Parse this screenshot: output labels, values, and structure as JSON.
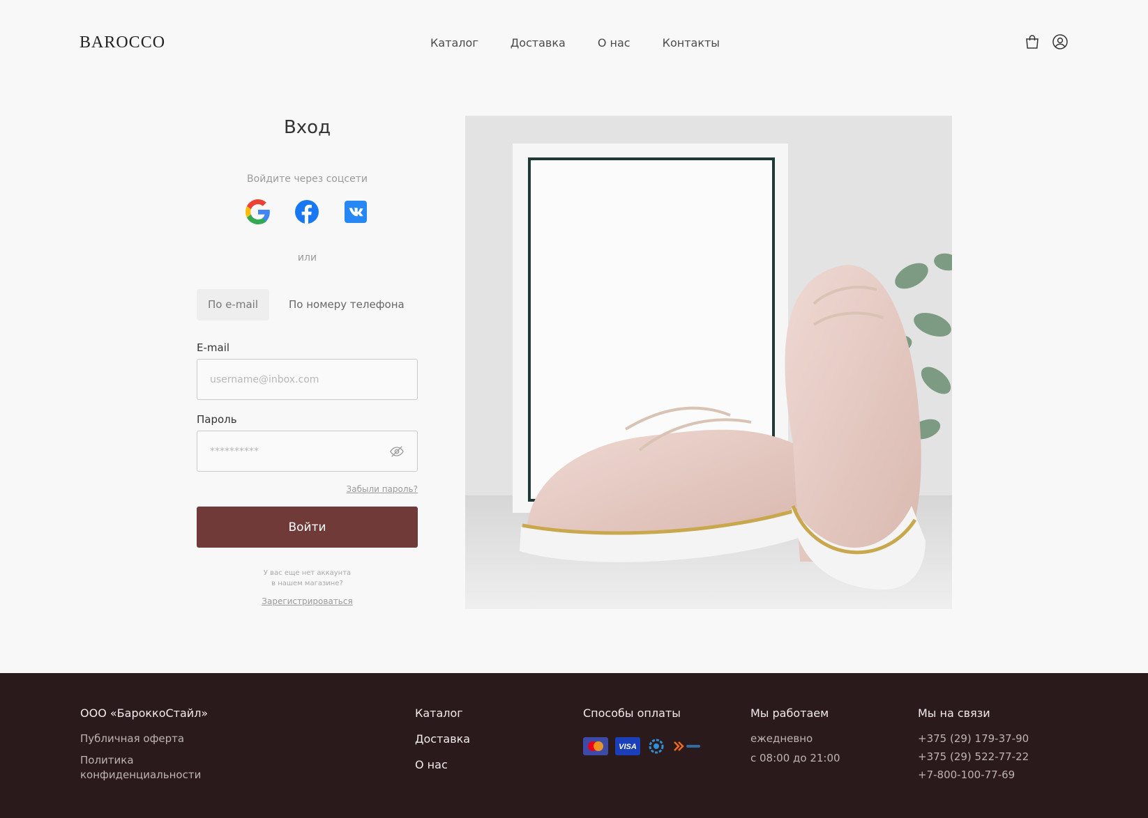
{
  "header": {
    "logo": "BAROCCO",
    "nav": [
      "Каталог",
      "Доставка",
      "О нас",
      "Контакты"
    ]
  },
  "login": {
    "title": "Вход",
    "social_caption": "Войдите через соцсети",
    "social": [
      "google-icon",
      "facebook-icon",
      "vk-icon"
    ],
    "or": "или",
    "tabs": [
      "По e-mail",
      "По номеру телефона"
    ],
    "email_label": "E-mail",
    "email_placeholder": "username@inbox.com",
    "password_label": "Пароль",
    "password_placeholder": "**********",
    "forgot": "Забыли пароль?",
    "submit": "Войти",
    "no_account_line1": "У вас еще нет аккаунта",
    "no_account_line2": "в нашем магазине?",
    "register": "Зарегистрироваться"
  },
  "colors": {
    "accent": "#6f3a37",
    "footer_bg": "#2b1a1b"
  },
  "footer": {
    "company": "ООО «БароккоСтайл»",
    "legal_links": [
      "Публичная оферта",
      "Политика конфиденциальности"
    ],
    "nav": [
      "Каталог",
      "Доставка",
      "О нас"
    ],
    "payment_title": "Способы оплаты",
    "payment_methods": [
      "mastercard-icon",
      "visa-icon",
      "belkart-icon",
      "erip-icon"
    ],
    "hours_title": "Мы работаем",
    "hours": [
      "ежедневно",
      "с 08:00 до 21:00"
    ],
    "contacts_title": "Мы на связи",
    "phones": [
      "+375 (29) 179-37-90",
      "+375 (29) 522-77-22",
      "+7-800-100-77-69"
    ]
  }
}
